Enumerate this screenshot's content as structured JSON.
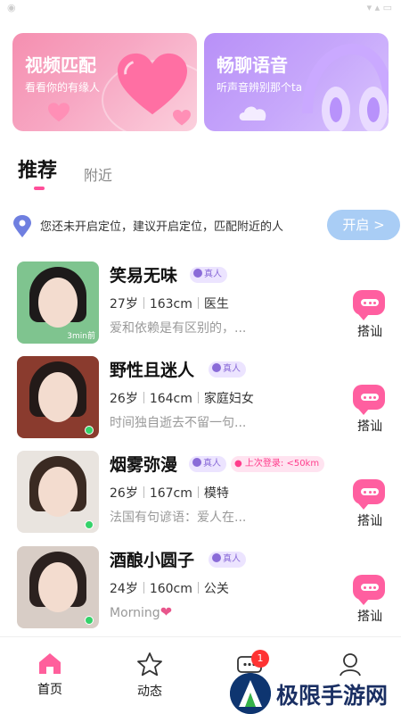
{
  "banners": {
    "video": {
      "title": "视频匹配",
      "subtitle": "看看你的有缘人"
    },
    "voice": {
      "title": "畅聊语音",
      "subtitle": "听声音辨别那个ta"
    }
  },
  "tabs": {
    "active": "推荐",
    "other": "附近"
  },
  "location": {
    "text": "您还未开启定位，建议开启定位，匹配附近的人",
    "button": "开启 >"
  },
  "users": [
    {
      "name": "笑易无味",
      "verified": "真人",
      "age": "27岁",
      "height": "163cm",
      "job": "医生",
      "bio": "爱和依赖是有区别的，...",
      "last_active": "3min前",
      "online": false,
      "hair": "#1d1a1a",
      "bg": "#7fc48f"
    },
    {
      "name": "野性且迷人",
      "verified": "真人",
      "age": "26岁",
      "height": "164cm",
      "job": "家庭妇女",
      "bio": "时间独自逝去不留一句...",
      "online": true,
      "hair": "#231a18",
      "bg": "#8a3b2e"
    },
    {
      "name": "烟雾弥漫",
      "verified": "真人",
      "last_login": "上次登录: <50km",
      "age": "26岁",
      "height": "167cm",
      "job": "模特",
      "bio": "法国有句谚语：爱人在...",
      "online": true,
      "hair": "#3a2a22",
      "bg": "#e9e4df"
    },
    {
      "name": "酒酿小圆子",
      "verified": "真人",
      "age": "24岁",
      "height": "160cm",
      "job": "公关",
      "bio": "Morning",
      "bio_emoji": "❤",
      "online": true,
      "hair": "#2b211f",
      "bg": "#d8cdc6"
    }
  ],
  "chat_label": "搭讪",
  "nav": [
    {
      "label": "首页",
      "icon": "home-icon",
      "active": true
    },
    {
      "label": "动态",
      "icon": "star-icon",
      "active": false
    },
    {
      "label": "",
      "icon": "message-icon",
      "badge": "1",
      "active": false
    },
    {
      "label": "",
      "icon": "profile-icon",
      "active": false
    }
  ],
  "watermark": "极限手游网",
  "colors": {
    "accent": "#ff4f9a",
    "verified": "#8a6bd8",
    "locate_button": "#a9cdf5",
    "online": "#35d26a"
  }
}
